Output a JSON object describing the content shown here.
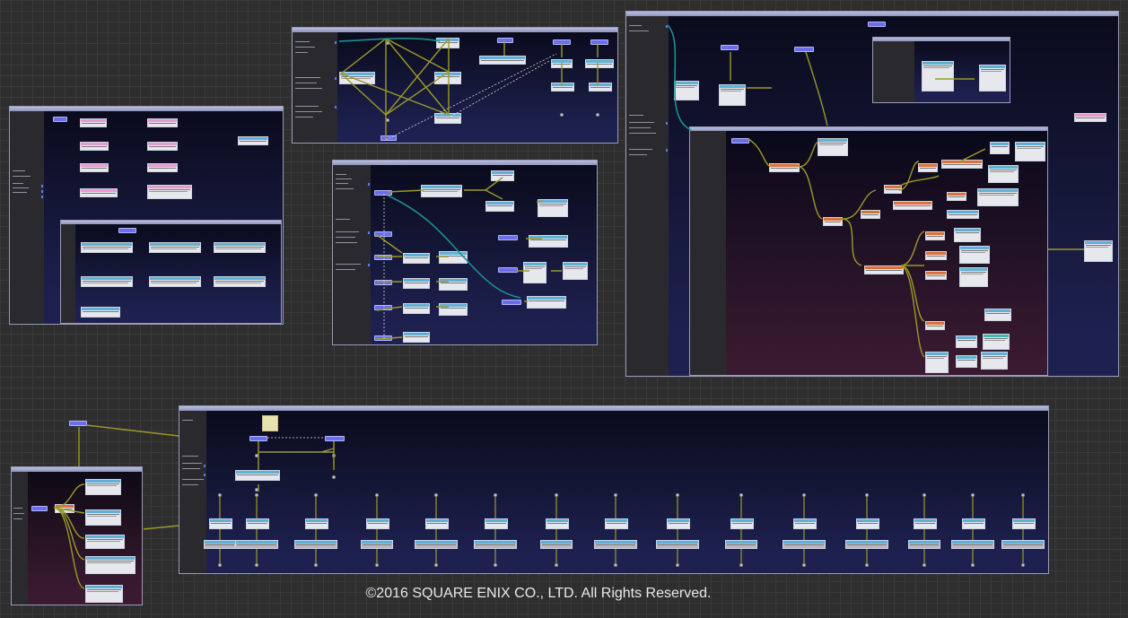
{
  "footer": {
    "copyright": "©2016 SQUARE ENIX CO., LTD. All Rights Reserved."
  },
  "colors": {
    "canvas_background": "#2e2e2e",
    "grid_line": "#3a3a3a",
    "window_border": "#9a9ab8",
    "blue_panel_top": "#0a0b1c",
    "blue_panel_bottom": "#1e2150",
    "red_panel_bottom": "#3a1a30",
    "wire_olive": "#9a9a28",
    "wire_teal": "#1d8f8f",
    "start_node": "#6a6ee8"
  },
  "icons": {
    "graph_editor": "node-graph-icon",
    "wire": "connection-wire-icon"
  }
}
